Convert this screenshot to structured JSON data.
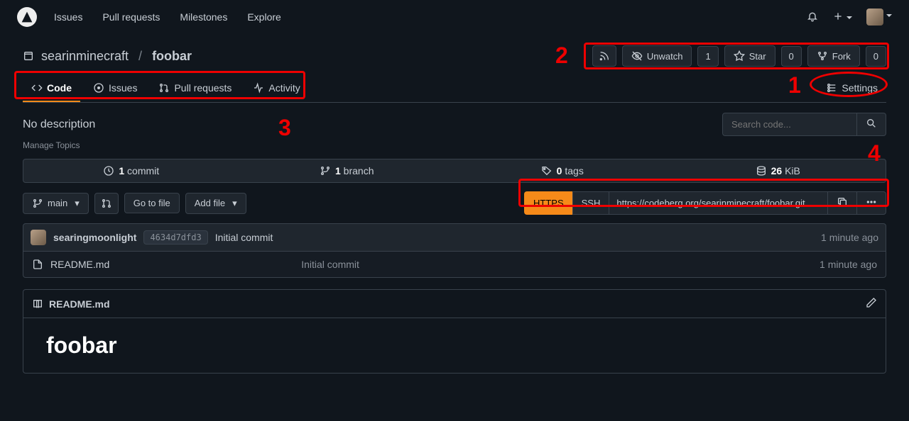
{
  "nav": {
    "items": [
      "Issues",
      "Pull requests",
      "Milestones",
      "Explore"
    ]
  },
  "repo": {
    "owner": "searinminecraft",
    "name": "foobar"
  },
  "actions": {
    "unwatch": "Unwatch",
    "unwatch_count": "1",
    "star": "Star",
    "star_count": "0",
    "fork": "Fork",
    "fork_count": "0"
  },
  "tabs": {
    "code": "Code",
    "issues": "Issues",
    "pulls": "Pull requests",
    "activity": "Activity",
    "settings": "Settings"
  },
  "desc": {
    "text": "No description",
    "manage": "Manage Topics",
    "search_placeholder": "Search code..."
  },
  "stats": {
    "commits_n": "1",
    "commits_l": " commit",
    "branches_n": "1",
    "branches_l": " branch",
    "tags_n": "0",
    "tags_l": " tags",
    "size_n": "26",
    "size_l": " KiB"
  },
  "toolbar": {
    "branch": "main",
    "goto": "Go to file",
    "add": "Add file",
    "https": "HTTPS",
    "ssh": "SSH",
    "url": "https://codeberg.org/searinminecraft/foobar.git"
  },
  "commit": {
    "author": "searingmoonlight",
    "sha": "4634d7dfd3",
    "msg": "Initial commit",
    "time": "1 minute ago"
  },
  "file": {
    "name": "README.md",
    "msg": "Initial commit",
    "time": "1 minute ago"
  },
  "readme": {
    "title": "README.md",
    "heading": "foobar"
  },
  "annotations": {
    "n1": "1",
    "n2": "2",
    "n3": "3",
    "n4": "4"
  }
}
